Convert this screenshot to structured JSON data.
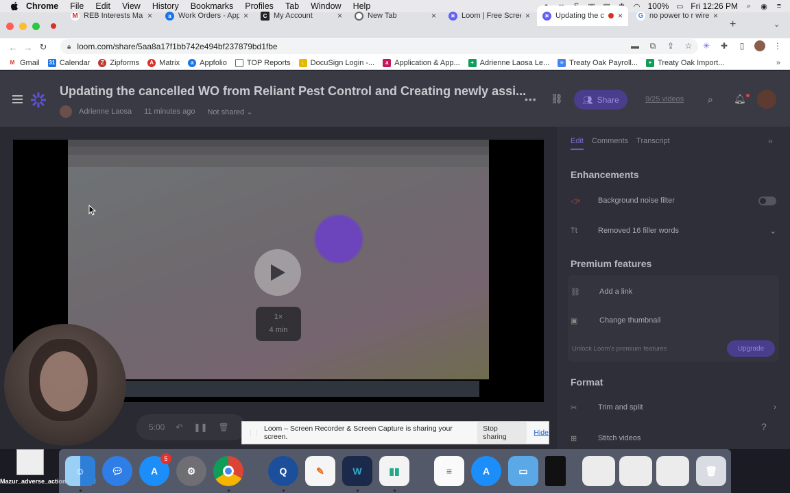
{
  "menubar": {
    "items": [
      "Chrome",
      "File",
      "Edit",
      "View",
      "History",
      "Bookmarks",
      "Profiles",
      "Tab",
      "Window",
      "Help"
    ],
    "battery": "100%",
    "clock": "Fri 12:26 PM"
  },
  "tabs": [
    {
      "title": "REB Interests Mail",
      "fav": "M",
      "color": "#d93025"
    },
    {
      "title": "Work Orders - App",
      "fav": "a",
      "color": "#1a73e8"
    },
    {
      "title": "My Account",
      "fav": "C",
      "color": "#222222"
    },
    {
      "title": "New Tab",
      "fav": "",
      "color": "#5f6368"
    },
    {
      "title": "Loom | Free Scree",
      "fav": "",
      "color": "#625df5"
    },
    {
      "title": "Updating the c",
      "fav": "",
      "color": "#625df5"
    },
    {
      "title": "no power to r wire",
      "fav": "G",
      "color": "#4285f4"
    }
  ],
  "address": {
    "url": "loom.com/share/5aa8a17f1bb742e494bf237879bd1fbe"
  },
  "bookmarks": [
    {
      "label": "Gmail",
      "color": "#d93025",
      "glyph": "M"
    },
    {
      "label": "Calendar",
      "color": "#1a73e8",
      "glyph": "31"
    },
    {
      "label": "Zipforms",
      "color": "#c0392b",
      "glyph": "Z"
    },
    {
      "label": "Matrix",
      "color": "#d93025",
      "glyph": "A"
    },
    {
      "label": "Appfolio",
      "color": "#1a73e8",
      "glyph": "a"
    },
    {
      "label": "TOP Reports",
      "color": "#5f6368",
      "glyph": ""
    },
    {
      "label": "DocuSign Login -...",
      "color": "#e6b800",
      "glyph": "↓"
    },
    {
      "label": "Application & App...",
      "color": "#c2185b",
      "glyph": "a"
    },
    {
      "label": "Adrienne Laosa Le...",
      "color": "#0f9d58",
      "glyph": "+"
    },
    {
      "label": "Treaty Oak Payroll...",
      "color": "#4285f4",
      "glyph": "≡"
    },
    {
      "label": "Treaty Oak Import...",
      "color": "#0f9d58",
      "glyph": "+"
    }
  ],
  "loom": {
    "title": "Updating the cancelled WO from Reliant Pest Control and Creating newly assi...",
    "author": "Adrienne Laosa",
    "time_ago": "11 minutes ago",
    "sharing_status": "Not shared",
    "share_label": "Share",
    "videos_count": "9/25 videos",
    "speed": "1×",
    "duration": "4 min",
    "player_time": "5:00"
  },
  "panel": {
    "tabs": [
      "Edit",
      "Comments",
      "Transcript"
    ],
    "enhancements_title": "Enhancements",
    "noise_filter": "Background noise filter",
    "filler_words": "Removed 16 filler words",
    "premium_title": "Premium features",
    "add_link": "Add a link",
    "change_thumb": "Change thumbnail",
    "unlock_text": "Unlock Loom's premium features",
    "upgrade_label": "Upgrade",
    "format_title": "Format",
    "trim_split": "Trim and split",
    "stitch": "Stitch videos"
  },
  "share_notice": {
    "text": "Loom – Screen Recorder & Screen Capture is sharing your screen.",
    "stop_label": "Stop sharing",
    "hide_label": "Hide"
  },
  "dock": {
    "mail_badge": "5",
    "desktop_file": "Mazur_adverse_action_letter.pdf"
  }
}
